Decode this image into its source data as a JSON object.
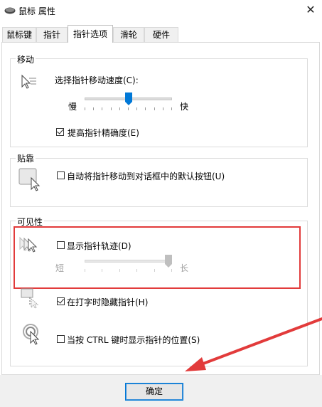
{
  "window": {
    "title": "鼠标 属性",
    "close_glyph": "✕"
  },
  "tabs": [
    {
      "label": "鼠标键",
      "active": false
    },
    {
      "label": "指针",
      "active": false
    },
    {
      "label": "指针选项",
      "active": true
    },
    {
      "label": "滑轮",
      "active": false
    },
    {
      "label": "硬件",
      "active": false
    }
  ],
  "motion": {
    "group_title": "移动",
    "speed_label": "选择指针移动速度(C):",
    "slow_label": "慢",
    "fast_label": "快",
    "speed_level": 0.5,
    "precision_label": "提高指针精确度(E)",
    "precision_checked": true,
    "icon": "pointer-speed-icon"
  },
  "snap": {
    "group_title": "贴靠",
    "checkbox_label": "自动将指针移动到对话框中的默认按钮(U)",
    "checked": false,
    "icon": "snap-to-default-icon"
  },
  "visibility": {
    "group_title": "可见性",
    "trails_label": "显示指针轨迹(D)",
    "trails_checked": false,
    "short_label": "短",
    "long_label": "长",
    "trail_length_level": 1.0,
    "hide_label": "在打字时隐藏指针(H)",
    "hide_checked": true,
    "ctrl_label": "当按 CTRL 键时显示指针的位置(S)",
    "ctrl_checked": false,
    "icons": [
      "pointer-trails-icon",
      "hide-while-typing-icon",
      "ctrl-locate-icon"
    ]
  },
  "footer": {
    "ok_label": "确定"
  },
  "colors": {
    "accent": "#0078d7",
    "highlight": "#e23b3b",
    "arrow": "#e23b3b"
  }
}
